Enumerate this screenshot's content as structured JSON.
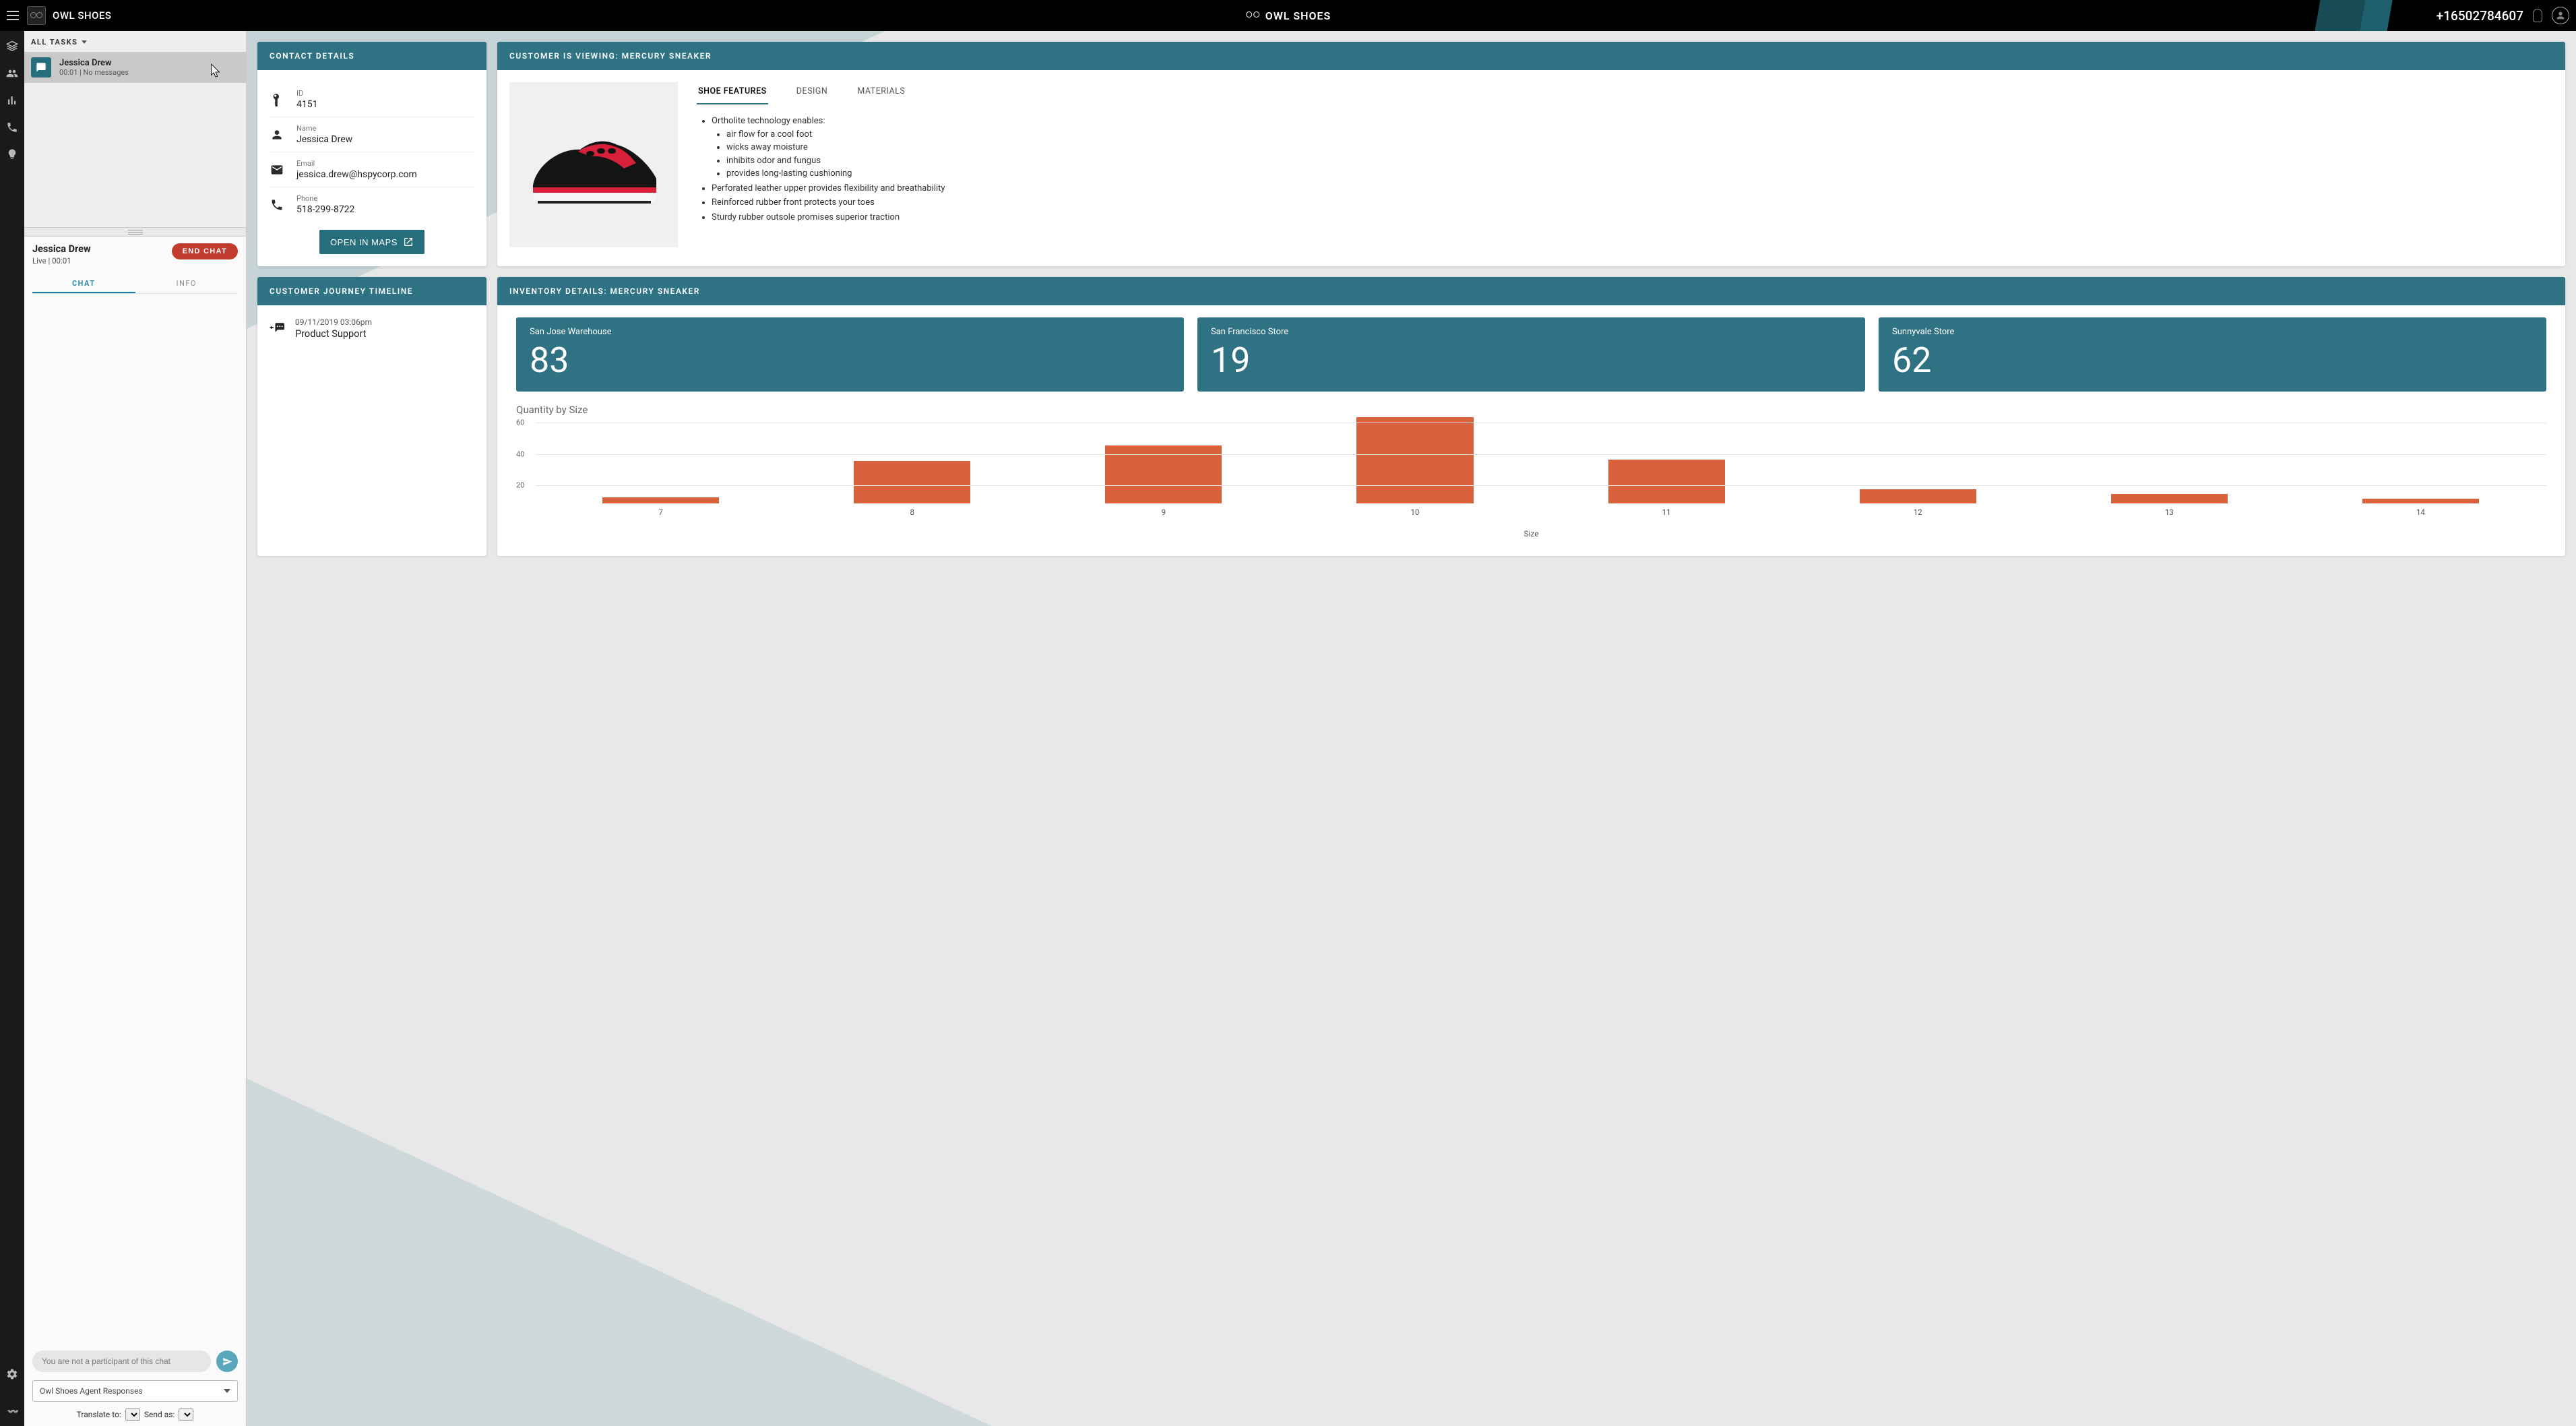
{
  "header": {
    "brand_left": "OWL SHOES",
    "brand_center": "OWL SHOES",
    "phone": "+16502784607"
  },
  "tasks": {
    "filter_label": "ALL TASKS",
    "items": [
      {
        "name": "Jessica Drew",
        "meta": "00:01 | No messages"
      }
    ]
  },
  "conversation": {
    "name": "Jessica Drew",
    "meta": "Live | 00:01",
    "end_chat_label": "END CHAT",
    "tabs": {
      "chat": "CHAT",
      "info": "INFO"
    },
    "chat_placeholder": "You are not a participant of this chat",
    "responses_label": "Owl Shoes Agent Responses",
    "translate_label": "Translate to:",
    "sendas_label": "Send as:"
  },
  "contact": {
    "title": "CONTACT DETAILS",
    "id_label": "ID",
    "id_value": "4151",
    "name_label": "Name",
    "name_value": "Jessica Drew",
    "email_label": "Email",
    "email_value": "jessica.drew@hspycorp.com",
    "phone_label": "Phone",
    "phone_value": "518-299-8722",
    "open_maps": "OPEN IN MAPS"
  },
  "journey": {
    "title": "CUSTOMER JOURNEY TIMELINE",
    "items": [
      {
        "ts": "09/11/2019 03:06pm",
        "event": "Product Support"
      }
    ]
  },
  "viewing": {
    "title": "CUSTOMER IS VIEWING: MERCURY SNEAKER",
    "tabs": {
      "features": "SHOE FEATURES",
      "design": "DESIGN",
      "materials": "MATERIALS"
    },
    "features": [
      "Ortholite technology enables:",
      [
        "air flow for a cool foot",
        "wicks away moisture",
        "inhibits odor and fungus",
        "provides long-lasting cushioning"
      ],
      "Perforated leather upper provides flexibility and breathability",
      "Reinforced rubber front protects your toes",
      "Sturdy rubber outsole promises superior traction"
    ]
  },
  "inventory": {
    "title": "INVENTORY DETAILS: MERCURY SNEAKER",
    "locations": [
      {
        "name": "San Jose Warehouse",
        "qty": "83"
      },
      {
        "name": "San Francisco Store",
        "qty": "19"
      },
      {
        "name": "Sunnyvale Store",
        "qty": "62"
      }
    ],
    "chart_title": "Quantity by Size",
    "chart_xaxis": "Size"
  },
  "chart_data": {
    "type": "bar",
    "title": "Quantity by Size",
    "xlabel": "Size",
    "ylabel": "",
    "ylim": [
      0,
      60
    ],
    "yticks": [
      20,
      40,
      60
    ],
    "categories": [
      "7",
      "8",
      "9",
      "10",
      "11",
      "12",
      "13",
      "14"
    ],
    "values": [
      4,
      27,
      37,
      55,
      28,
      9,
      6,
      3
    ]
  },
  "colors": {
    "teal": "#2e7284",
    "bar": "#d9623d",
    "danger": "#c23b2e"
  }
}
